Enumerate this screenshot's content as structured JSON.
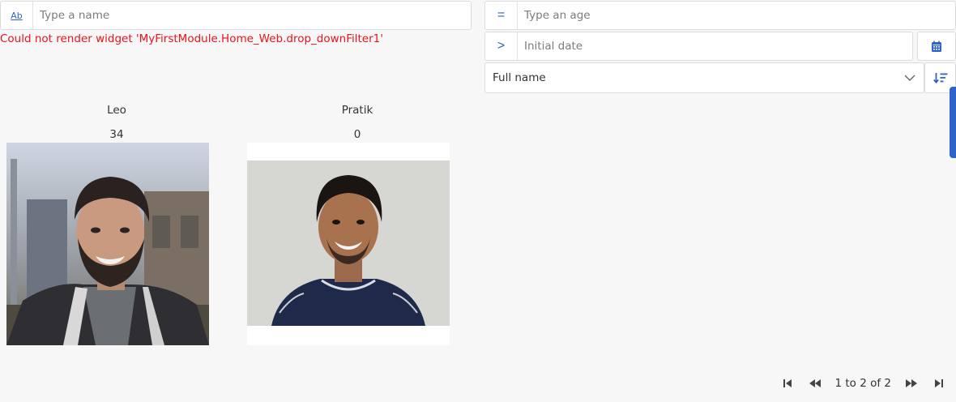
{
  "filters": {
    "name": {
      "prefix_label": "Ab",
      "placeholder": "Type a name",
      "value": ""
    },
    "age": {
      "prefix_label": "=",
      "placeholder": "Type an age",
      "value": ""
    },
    "date": {
      "prefix_label": ">",
      "placeholder": "Initial date",
      "value": ""
    },
    "sort": {
      "selected": "Full name",
      "options": [
        "Full name"
      ]
    }
  },
  "error": {
    "message": "Could not render widget 'MyFirstModule.Home_Web.drop_downFilter1'"
  },
  "cards": [
    {
      "name": "Leo",
      "age": "34"
    },
    {
      "name": "Pratik",
      "age": "0"
    }
  ],
  "pagination": {
    "label": "1 to 2 of 2"
  },
  "colors": {
    "accent": "#2e63c9",
    "error": "#e8141b",
    "background": "#f7f7f7"
  },
  "icons": {
    "calendar": "calendar-icon",
    "chevron_down": "chevron-down-icon",
    "sort": "sort-icon",
    "first": "first-page-icon",
    "prev": "previous-page-icon",
    "next": "next-page-icon",
    "last": "last-page-icon"
  }
}
